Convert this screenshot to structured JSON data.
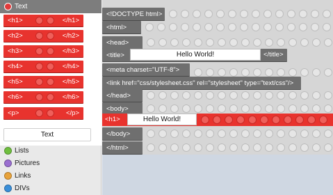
{
  "palette": {
    "active_category": "Text",
    "categories": [
      "Lists",
      "Pictures",
      "Links",
      "DIVs"
    ],
    "category_colors": {
      "Text": "#e23a3a",
      "Lists": "#6fbf3f",
      "Pictures": "#9a6fd0",
      "Links": "#e8a23a",
      "DIVs": "#3a8fd9"
    },
    "blocks": [
      {
        "open": "<h1>",
        "close": "</h1>"
      },
      {
        "open": "<h2>",
        "close": "</h2>"
      },
      {
        "open": "<h3>",
        "close": "</h3>"
      },
      {
        "open": "<h4>",
        "close": "</h4>"
      },
      {
        "open": "<h5>",
        "close": "</h5>"
      },
      {
        "open": "<h6>",
        "close": "</h6>"
      },
      {
        "open": "<p>",
        "close": "</p>"
      }
    ],
    "text_block": "Text"
  },
  "workspace": {
    "doctype": "<!DOCTYPE html>",
    "html_open": "<html>",
    "head_open": "<head>",
    "title_open": "<title>",
    "title_value": "Hello World!",
    "title_close": "</title>",
    "meta": "<meta charset=\"UTF-8\">",
    "link": "<link href=\"css/stylesheet.css\" rel=\"stylesheet\" type=\"text/css\"/>",
    "head_close": "</head>",
    "body_open": "<body>",
    "h1_open": "<h1>",
    "h1_value": "Hello World!",
    "body_close": "</body>",
    "html_close": "</html>"
  },
  "colors": {
    "tag_red": "#e8332e",
    "tag_gray": "#6f6f6f",
    "accent": "#7d7d7d"
  }
}
